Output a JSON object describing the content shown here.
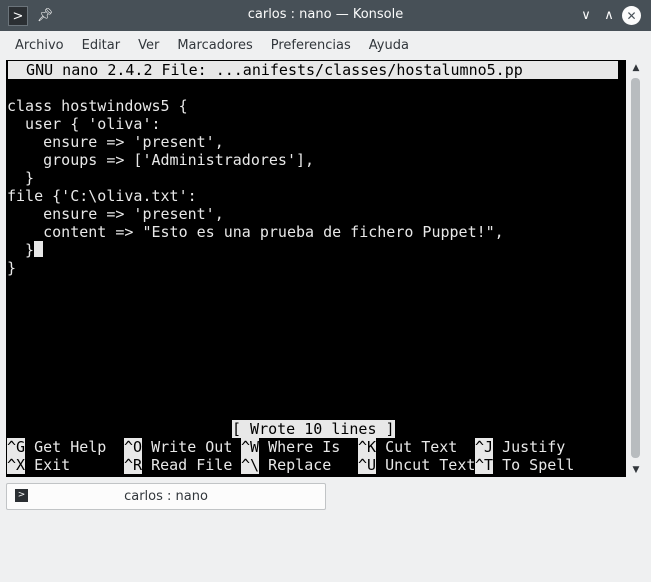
{
  "window": {
    "title": "carlos : nano — Konsole",
    "icons": {
      "app": "terminal-icon",
      "pin": "pin-icon",
      "minimize": "chevron-down-icon",
      "maximize": "chevron-up-icon",
      "close": "close-icon"
    }
  },
  "menubar": {
    "items": [
      "Archivo",
      "Editar",
      "Ver",
      "Marcadores",
      "Preferencias",
      "Ayuda"
    ]
  },
  "nano": {
    "header": "  GNU nano 2.4.2 File: ...anifests/classes/hostalumno5.pp",
    "lines": [
      "",
      "class hostwindows5 {",
      "  user { 'oliva':",
      "    ensure => 'present',",
      "    groups => ['Administradores'],",
      "  }",
      "file {'C:\\oliva.txt':",
      "    ensure => 'present',",
      "    content => \"Esto es una prueba de fichero Puppet!\",",
      "  }",
      "}"
    ],
    "status": "[ Wrote 10 lines ]",
    "shortcuts_row1": [
      {
        "key": "^G",
        "label": " Get Help"
      },
      {
        "key": "^O",
        "label": " Write Out"
      },
      {
        "key": "^W",
        "label": " Where Is"
      },
      {
        "key": "^K",
        "label": " Cut Text"
      },
      {
        "key": "^J",
        "label": " Justify"
      }
    ],
    "shortcuts_row2": [
      {
        "key": "^X",
        "label": " Exit"
      },
      {
        "key": "^R",
        "label": " Read File"
      },
      {
        "key": "^\\",
        "label": " Replace"
      },
      {
        "key": "^U",
        "label": " Uncut Text"
      },
      {
        "key": "^T",
        "label": " To Spell"
      }
    ]
  },
  "tabs": [
    {
      "label": "carlos : nano",
      "icon": "terminal-icon"
    }
  ],
  "colors": {
    "titlebar": "#475057",
    "terminal_bg": "#000000",
    "terminal_fg": "#e8e8e8",
    "chrome": "#eff0f1"
  }
}
